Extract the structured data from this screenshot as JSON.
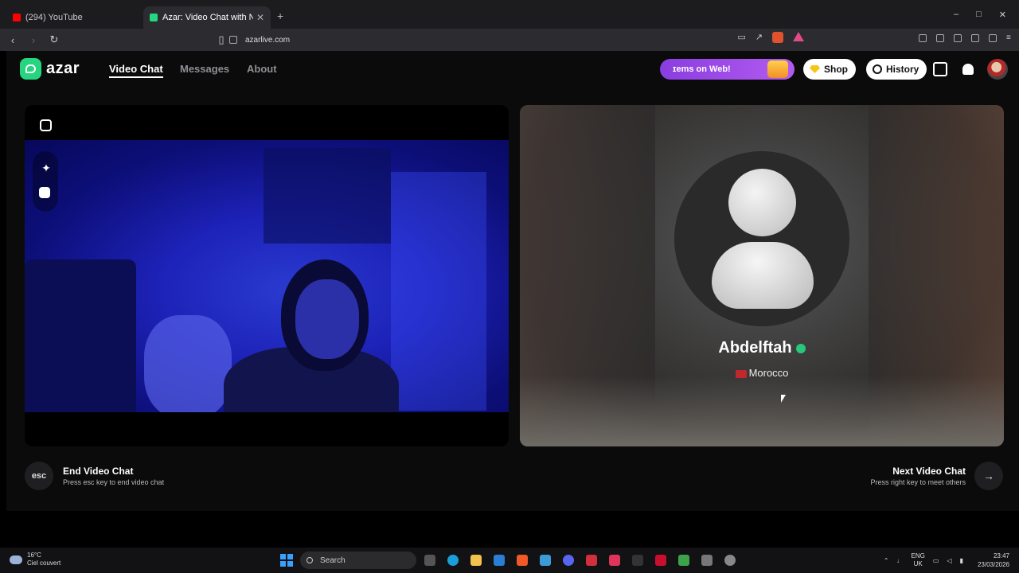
{
  "browser": {
    "tabs": [
      {
        "title": "(294) YouTube",
        "active": false,
        "favicon_color": "#ff0000"
      },
      {
        "title": "Azar: Video Chat with New Pe",
        "active": true,
        "favicon_color": "#25d57f"
      }
    ],
    "new_tab": "+",
    "url": "azarlive.com",
    "window_controls": [
      "–",
      "□",
      "✕"
    ]
  },
  "header": {
    "logo_text": "azar",
    "nav": [
      {
        "label": "Video Chat",
        "active": true
      },
      {
        "label": "Messages",
        "active": false
      },
      {
        "label": "About",
        "active": false
      }
    ],
    "promo_text": "ɪems on Web!",
    "shop_label": "Shop",
    "history_label": "History"
  },
  "peer": {
    "name": "Abdelftah",
    "country": "Morocco"
  },
  "controls": {
    "esc_label": "esc",
    "end_title": "End Video Chat",
    "end_hint": "Press esc key to end video chat",
    "next_title": "Next Video Chat",
    "next_hint": "Press right key to meet others",
    "next_arrow": "→"
  },
  "taskbar": {
    "weather_temp": "16°C",
    "weather_desc": "Ciel couvert",
    "search_placeholder": "Search",
    "lang_line1": "ENG",
    "lang_line2": "UK",
    "time": "23:47",
    "date": "23/03/2026"
  },
  "colors": {
    "accent": "#25d57f",
    "promo": "#9a4be8",
    "page_bg": "#0b0b0c"
  }
}
